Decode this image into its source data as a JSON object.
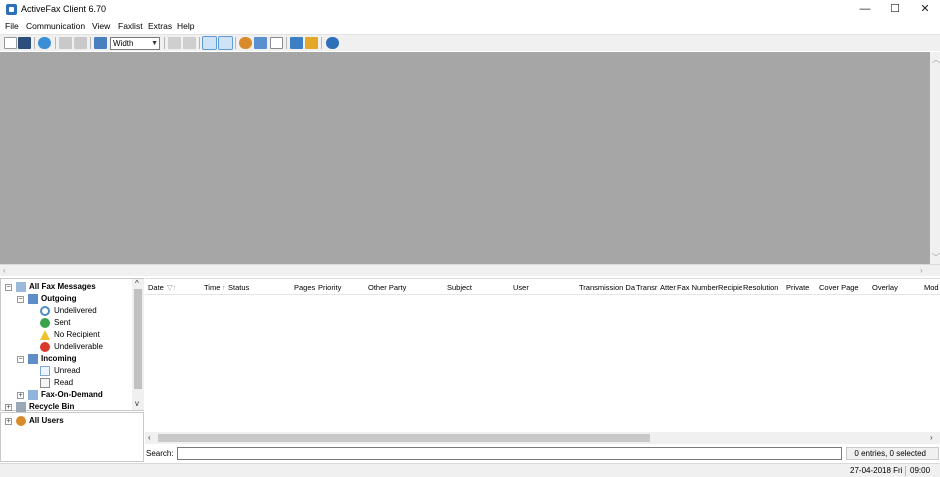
{
  "window": {
    "title": "ActiveFax Client 6.70",
    "minimize_glyph": "—",
    "maximize_glyph": "☐",
    "close_glyph": "✕"
  },
  "menu": [
    "File",
    "Communication",
    "View",
    "Faxlist",
    "Extras",
    "Help"
  ],
  "toolbar": {
    "zoom_select_value": "Width",
    "icons": [
      "new-icon",
      "save-icon",
      "refresh-icon",
      "print-icon",
      "print-preview-icon",
      "monitor-icon",
      "fit-page-icon",
      "page-view-icon",
      "list-view-icon",
      "preview-pane-icon",
      "users-icon",
      "phonebook-icon",
      "document-icon",
      "settings-icon",
      "key-icon",
      "help-icon"
    ]
  },
  "tree": {
    "root": "All Fax Messages",
    "outgoing": "Outgoing",
    "undelivered": "Undelivered",
    "sent": "Sent",
    "no_recipient": "No Recipient",
    "undeliverable": "Undeliverable",
    "incoming": "Incoming",
    "unread": "Unread",
    "read": "Read",
    "fax_on_demand": "Fax-On-Demand",
    "recycle_bin": "Recycle Bin"
  },
  "users": {
    "all_users": "All Users"
  },
  "list": {
    "columns": [
      "Date",
      "Time",
      "Status",
      "Pages",
      "Priority",
      "Other Party",
      "Subject",
      "User",
      "Transmission Dat",
      "Transr",
      "Atter",
      "Fax Number",
      "Recipie",
      "Resolution",
      "Private",
      "Cover Page",
      "Overlay",
      "Mod"
    ],
    "rows": []
  },
  "search": {
    "label": "Search:",
    "value": ""
  },
  "status": {
    "count": "0 entries, 0 selected",
    "date": "27-04-2018 Fri",
    "time": "09:00"
  },
  "colors": {
    "preview_background": "#a6a6a6",
    "toolbar_background": "#f0f0f0",
    "accent": "#2d6fb8"
  }
}
